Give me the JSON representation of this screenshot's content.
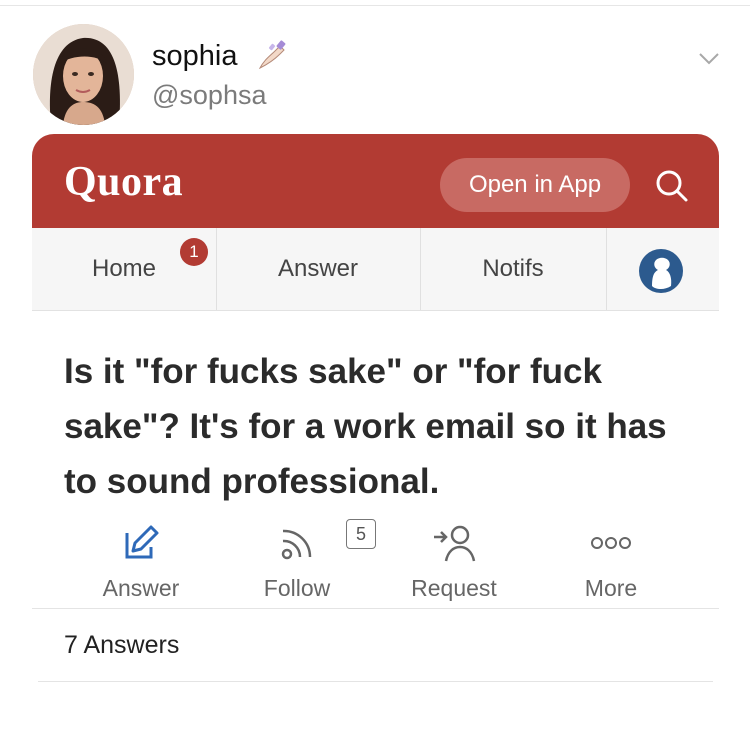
{
  "tweet": {
    "display_name": "sophia",
    "handle": "@sophsa",
    "emoji_icon": "nail-polish-icon",
    "menu_icon": "chevron-down-icon"
  },
  "quora": {
    "logo": "Quora",
    "open_in_app": "Open in App",
    "brand_color": "#b23b33",
    "nav": {
      "home": "Home",
      "home_badge": "1",
      "answer": "Answer",
      "notifs": "Notifs"
    },
    "question": "Is it \"for fucks sake\" or \"for fuck sake\"? It's for a work email so it has to sound professional.",
    "actions": {
      "answer": "Answer",
      "follow": "Follow",
      "follow_count": "5",
      "request": "Request",
      "more": "More"
    },
    "answers_count": "7 Answers"
  }
}
